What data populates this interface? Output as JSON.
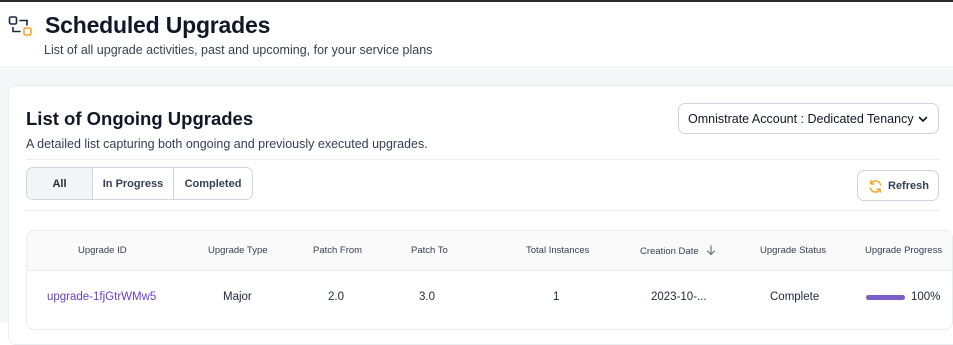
{
  "header": {
    "title": "Scheduled Upgrades",
    "subtitle": "List of all upgrade activities, past and upcoming, for your service plans",
    "icon": "schedule-upgrade-icon",
    "icon_color": "#f5a623"
  },
  "card": {
    "title": "List of Ongoing Upgrades",
    "description": "A detailed list capturing both ongoing and previously executed upgrades.",
    "account_selector": {
      "value": "Omnistrate Account : Dedicated Tenancy"
    },
    "tabs": [
      {
        "label": "All",
        "active": true
      },
      {
        "label": "In Progress",
        "active": false
      },
      {
        "label": "Completed",
        "active": false
      }
    ],
    "refresh_label": "Refresh"
  },
  "table": {
    "columns": [
      "Upgrade ID",
      "Upgrade Type",
      "Patch From",
      "Patch To",
      "Total Instances",
      "Creation Date",
      "Upgrade Status",
      "Upgrade Progress"
    ],
    "sorted_column": "Creation Date",
    "sort_direction": "descending",
    "rows": [
      {
        "upgrade_id": "upgrade-1fjGtrWMw5",
        "upgrade_type": "Major",
        "patch_from": "2.0",
        "patch_to": "3.0",
        "total_instances": "1",
        "creation_date": "2023-10-...",
        "status": "Complete",
        "progress_label": "100%",
        "progress_value": 1.0
      }
    ]
  },
  "colors": {
    "accent_purple": "#6941c6",
    "progress_fill": "#7c5cc9",
    "refresh_icon": "#f5a623"
  }
}
